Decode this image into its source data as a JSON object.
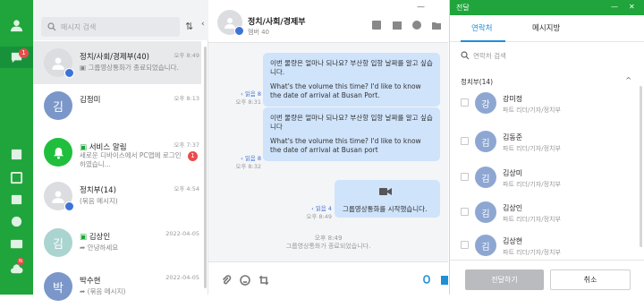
{
  "rail": {
    "chat_badge": "1",
    "bottom_badge": "N"
  },
  "list": {
    "search_placeholder": "메시지 검색",
    "items": [
      {
        "name": "정치/사회/경제부(40)",
        "preview": "그룹영상통화가 종료되었습니다.",
        "time": "오후 8:49",
        "avatar": ""
      },
      {
        "name": "김정미",
        "preview": "",
        "time": "오후 8:13",
        "avatar": "김"
      },
      {
        "name": "서비스 알림",
        "preview": "새로운 디바이스에서 PC앱에 로그인하였습니...",
        "time": "오후 7:37",
        "avatar": "",
        "badge": "1"
      },
      {
        "name": "정치부(14)",
        "preview": "(묶음 메시지)",
        "time": "오후 4:54",
        "avatar": ""
      },
      {
        "name": "김상인",
        "preview": "안녕하세요",
        "time": "2022-04-05",
        "avatar": "김"
      },
      {
        "name": "박수현",
        "preview": "(묶음 메시지)",
        "time": "2022-04-05",
        "avatar": "박"
      }
    ]
  },
  "chat": {
    "title": "정치/사회/경제부",
    "members": "멤버 40",
    "messages": [
      {
        "ko": "이번 물량은 얼마나 되나요? 부산항 입항 날짜를 알고 싶습니다.",
        "en": "What's the volume this time? I'd like to know the date of arrival at Busan Port.",
        "read": "읽음 8",
        "time": "오후 8:31"
      },
      {
        "ko": "이번 물량은 얼마나 되나요? 부산항 입항 날짜를 알고 싶습니다",
        "en": "What's the volume this time? I'd like to know the date of arrival at Busan port",
        "read": "읽음 8",
        "time": "오후 8:32"
      }
    ],
    "video_msg": "그룹영상통화를 시작했습니다.",
    "video_read": "읽음 4",
    "video_time": "오후 8:49",
    "system_time": "오후 8:49",
    "system_msg": "그룹영상통화가 종료되었습니다."
  },
  "forward": {
    "title": "전달",
    "tabs": [
      "연락처",
      "메시지방"
    ],
    "search_placeholder": "연락처 검색",
    "group": "정치부(14)",
    "people": [
      {
        "name": "강미정",
        "role": "파트 리더/기자/정치부",
        "avatar": "강"
      },
      {
        "name": "김동준",
        "role": "파트 리더/기자/정치부",
        "avatar": "김"
      },
      {
        "name": "김상미",
        "role": "파트 리더/기자/정치부",
        "avatar": "김"
      },
      {
        "name": "김상인",
        "role": "파트 리더/기자/정치부",
        "avatar": "김"
      },
      {
        "name": "김상현",
        "role": "파트 리더/기자/정치부",
        "avatar": "김"
      }
    ],
    "confirm": "전달하기",
    "cancel": "취소"
  },
  "colors": {
    "brand_green": "#1fa53b",
    "bubble_blue": "#cfe3fb",
    "accent_blue": "#1f8fd6"
  }
}
